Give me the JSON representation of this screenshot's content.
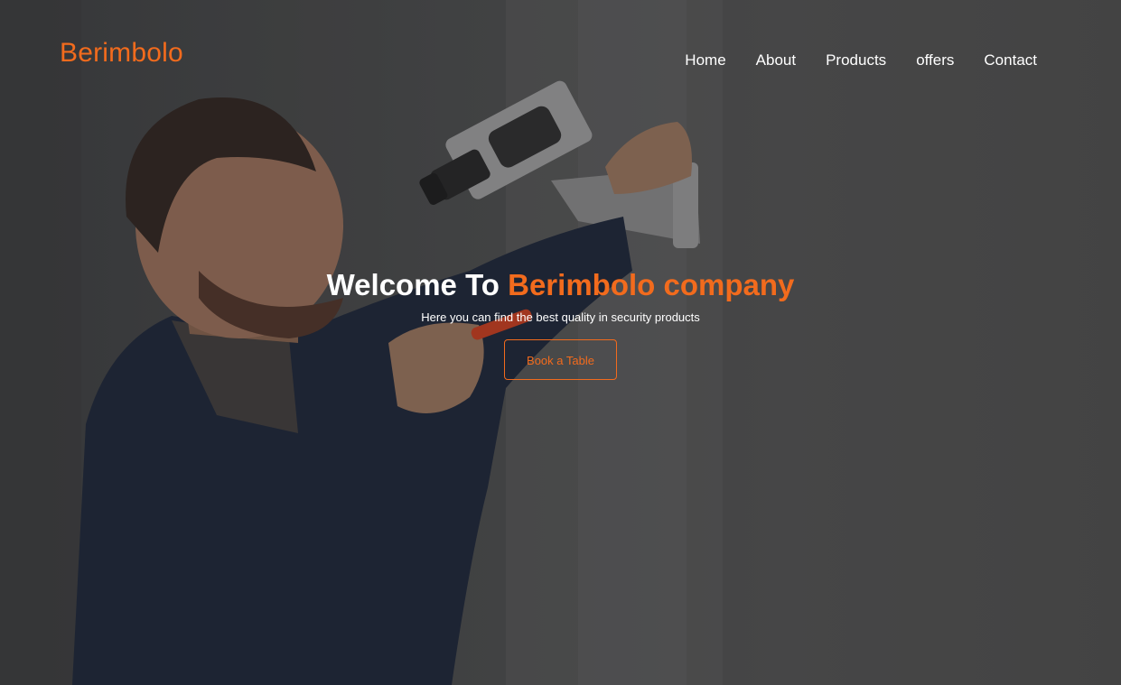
{
  "brand": {
    "name": "Berimbolo"
  },
  "nav": {
    "items": [
      {
        "label": "Home"
      },
      {
        "label": "About"
      },
      {
        "label": "Products"
      },
      {
        "label": "offers"
      },
      {
        "label": "Contact"
      }
    ]
  },
  "hero": {
    "title_prefix": "Welcome To",
    "title_accent": "Berimbolo company",
    "subtitle": "Here you can find the best quality in security products",
    "cta_label": "Book a Table",
    "image_subject": "technician installing security camera"
  },
  "colors": {
    "accent": "#f26b1d",
    "text": "#ffffff",
    "background": "#454647"
  }
}
